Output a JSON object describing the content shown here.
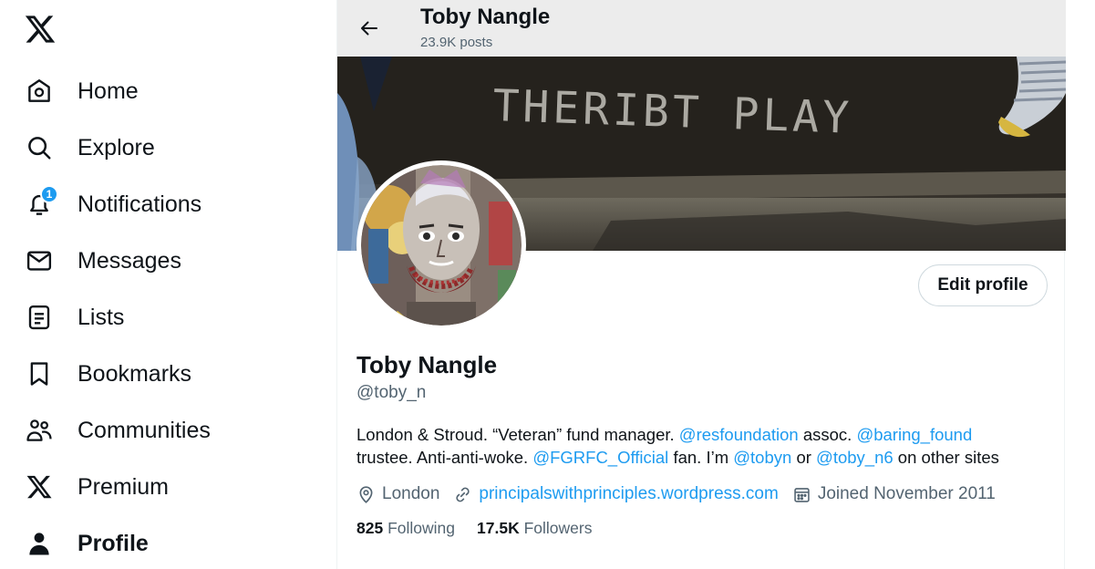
{
  "sidebar": {
    "logo_icon": "x-logo-icon",
    "items": [
      {
        "label": "Home",
        "icon": "home-icon"
      },
      {
        "label": "Explore",
        "icon": "search-icon"
      },
      {
        "label": "Notifications",
        "icon": "bell-icon",
        "badge": "1"
      },
      {
        "label": "Messages",
        "icon": "envelope-icon"
      },
      {
        "label": "Lists",
        "icon": "list-icon"
      },
      {
        "label": "Bookmarks",
        "icon": "bookmark-icon"
      },
      {
        "label": "Communities",
        "icon": "people-icon"
      },
      {
        "label": "Premium",
        "icon": "x-logo-icon"
      },
      {
        "label": "Profile",
        "icon": "person-icon",
        "active": true
      }
    ]
  },
  "header": {
    "name": "Toby Nangle",
    "posts": "23.9K posts"
  },
  "banner": {
    "chalk_text": "THERIBT PLAY"
  },
  "profile": {
    "edit_label": "Edit profile",
    "display_name": "Toby Nangle",
    "handle": "@toby_n",
    "bio": {
      "t1": "London & Stroud. “Veteran” fund manager. ",
      "m1": "@resfoundation",
      "t2": " assoc. ",
      "m2": "@baring_found",
      "t3": " trustee. Anti-anti-woke. ",
      "m3": "@FGRFC_Official",
      "t4": " fan. I’m ",
      "m4": "@tobyn",
      "t5": " or ",
      "m5": "@toby_n6",
      "t6": " on other sites"
    },
    "location": "London",
    "website": "principalswithprinciples.wordpress.com",
    "joined": "Joined November 2011",
    "following_count": "825",
    "following_label": "Following",
    "followers_count": "17.5K",
    "followers_label": "Followers"
  },
  "colors": {
    "accent": "#1d9bf0",
    "text": "#0f1419",
    "secondary": "#536471"
  }
}
